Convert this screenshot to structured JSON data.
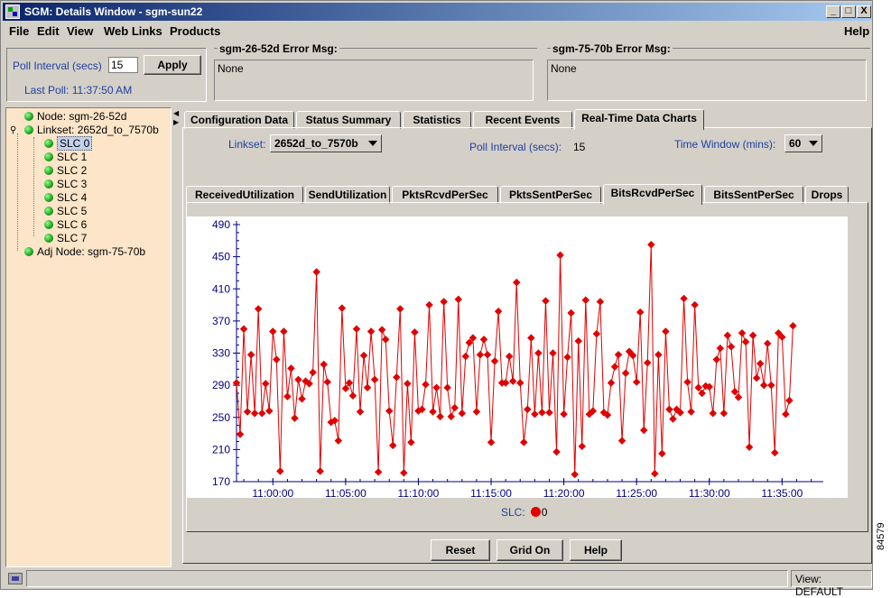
{
  "window": {
    "title": "SGM: Details Window - sgm-sun22",
    "minimize": "_",
    "maximize": "□",
    "close": "X"
  },
  "menu": {
    "file": "File",
    "edit": "Edit",
    "view": "View",
    "weblinks": "Web Links",
    "products": "Products",
    "help": "Help"
  },
  "poll": {
    "label": "Poll Interval (secs)",
    "value": "15",
    "apply": "Apply",
    "last_poll": "Last Poll:  11:37:50 AM"
  },
  "errors": [
    {
      "label": "sgm-26-52d  Error Msg:",
      "message": "None"
    },
    {
      "label": "sgm-75-70b  Error Msg:",
      "message": "None"
    }
  ],
  "tree": {
    "node": "Node: sgm-26-52d",
    "linkset": "Linkset: 2652d_to_7570b",
    "slcs": [
      "SLC 0",
      "SLC 1",
      "SLC 2",
      "SLC 3",
      "SLC 4",
      "SLC 5",
      "SLC 6",
      "SLC 7"
    ],
    "adj_node": "Adj Node: sgm-75-70b"
  },
  "tabs": {
    "main": [
      "Configuration Data",
      "Status Summary",
      "Statistics",
      "Recent Events",
      "Real-Time Data Charts"
    ],
    "main_active": 4,
    "sub": [
      "ReceivedUtilization",
      "SendUtilization",
      "PktsRcvdPerSec",
      "PktsSentPerSec",
      "BitsRcvdPerSec",
      "BitsSentPerSec",
      "Drops"
    ],
    "sub_active": 4
  },
  "controls": {
    "linkset_label": "Linkset:",
    "linkset_value": "2652d_to_7570b",
    "poll_label": "Poll Interval (secs):",
    "poll_value": "15",
    "window_label": "Time Window (mins):",
    "window_value": "60"
  },
  "buttons": {
    "reset": "Reset",
    "grid": "Grid On",
    "help": "Help"
  },
  "status": {
    "view": "View: DEFAULT"
  },
  "figure_number": "84579",
  "colors": {
    "series": "#e00000",
    "axis": "#000080",
    "tree_bg": "#fce5c8"
  },
  "chart_data": {
    "type": "line",
    "title": "",
    "xlabel": "",
    "ylabel": "",
    "ylim": [
      170,
      490
    ],
    "yticks": [
      490,
      450,
      410,
      370,
      330,
      290,
      250,
      210,
      170
    ],
    "xlim": [
      "10:57:30",
      "11:37:50"
    ],
    "xticks": [
      "11:00:00",
      "11:05:00",
      "11:10:00",
      "11:15:00",
      "11:20:00",
      "11:25:00",
      "11:30:00",
      "11:35:00"
    ],
    "legend_title": "SLC:",
    "grid": false,
    "series": [
      {
        "name": "0",
        "x_start": "10:57:30",
        "interval_secs": 15,
        "values": [
          293,
          229,
          360,
          257,
          328,
          255,
          385,
          255,
          292,
          258,
          357,
          322,
          183,
          357,
          276,
          311,
          249,
          297,
          273,
          295,
          292,
          306,
          431,
          183,
          316,
          294,
          244,
          246,
          221,
          386,
          286,
          293,
          277,
          360,
          257,
          327,
          287,
          357,
          297,
          182,
          359,
          347,
          258,
          215,
          300,
          385,
          181,
          292,
          219,
          356,
          258,
          260,
          291,
          390,
          257,
          287,
          251,
          394,
          287,
          251,
          262,
          397,
          255,
          326,
          343,
          349,
          257,
          328,
          347,
          328,
          219,
          320,
          382,
          293,
          293,
          326,
          295,
          418,
          293,
          219,
          260,
          349,
          254,
          330,
          256,
          395,
          256,
          330,
          207,
          452,
          254,
          325,
          380,
          179,
          345,
          214,
          396,
          254,
          258,
          354,
          394,
          256,
          253,
          293,
          313,
          328,
          221,
          305,
          332,
          327,
          294,
          381,
          234,
          318,
          465,
          180,
          328,
          205,
          357,
          260,
          248,
          260,
          256,
          398,
          294,
          257,
          390,
          287,
          280,
          289,
          288,
          255,
          322,
          336,
          255,
          352,
          338,
          282,
          275,
          355,
          344,
          213,
          352,
          299,
          317,
          290,
          342,
          290,
          206,
          355,
          350,
          254,
          271,
          364
        ]
      }
    ]
  }
}
